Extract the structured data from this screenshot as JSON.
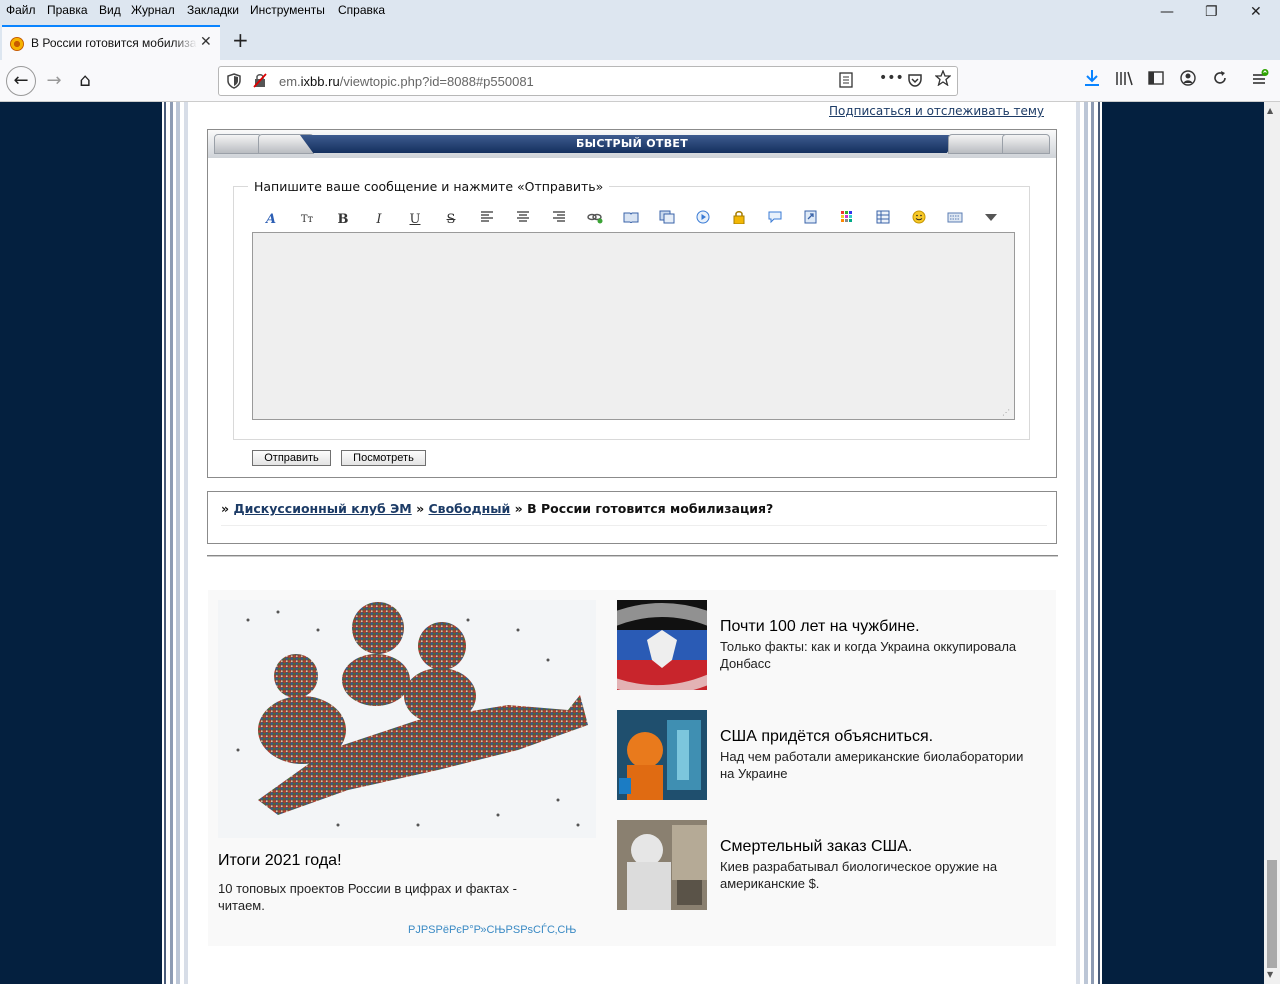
{
  "menubar": {
    "items": [
      "Файл",
      "Правка",
      "Вид",
      "Журнал",
      "Закладки",
      "Инструменты",
      "Справка"
    ]
  },
  "window_controls": {
    "minimize": "—",
    "restore": "❐",
    "close": "✕"
  },
  "tab": {
    "title": "В России готовится мобилиза",
    "close": "✕"
  },
  "newtab": "+",
  "nav": {
    "back": "←",
    "forward": "→",
    "home": "⌂",
    "url_prefix": "em.",
    "url_domain": "ixbb.ru",
    "url_path": "/viewtopic.php?id=8088#p550081",
    "page_actions": "•••"
  },
  "forum": {
    "subscribe_link": "Подписаться и отслеживать тему",
    "quick_reply": {
      "header": "БЫСТРЫЙ ОТВЕТ",
      "legend": "Напишите ваше сообщение и нажмите «Отправить»",
      "textarea_value": "",
      "submit_label": "Отправить",
      "preview_label": "Посмотреть"
    },
    "breadcrumbs": {
      "sep": "»",
      "crumb1": "Дискуссионный клуб ЭМ",
      "crumb2": "Свободный",
      "current": "В России готовится мобилизация?"
    }
  },
  "promo": {
    "main": {
      "title": "Итоги 2021 года!",
      "text": "10 топовых проектов России в цифрах и фактах - читаем.",
      "footer": "РЈРЅРёРєР°Р»СЊРЅРѕСЃС‚СЊ"
    },
    "side": [
      {
        "title": "Почти 100 лет на чужбине.",
        "desc": "Только факты: как и когда Украина оккупировала Донбасс"
      },
      {
        "title": "США придётся объясниться.",
        "desc": "Над чем работали американские биолаборатории на Украине"
      },
      {
        "title": "Смертельный заказ США.",
        "desc": "Киев разрабатывал биологическое оружие на американские $."
      }
    ]
  },
  "colors": {
    "page_bg": "#04203f",
    "header_band": "#1f3f74",
    "link": "#1c3b66"
  }
}
